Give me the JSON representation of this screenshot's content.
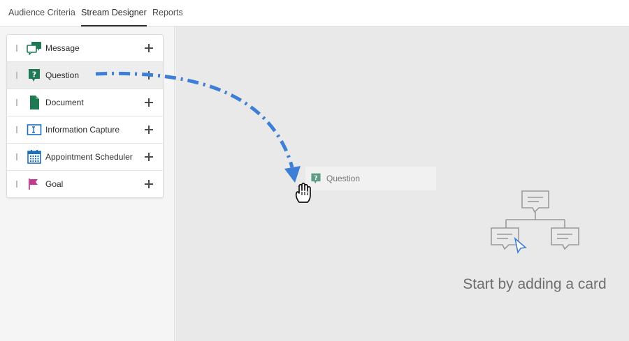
{
  "tabs": [
    {
      "label": "Audience Criteria",
      "active": false
    },
    {
      "label": "Stream Designer",
      "active": true
    },
    {
      "label": "Reports",
      "active": false
    }
  ],
  "cards": [
    {
      "label": "Message",
      "icon": "message-icon",
      "color": "#1e7a52"
    },
    {
      "label": "Question",
      "icon": "question-icon",
      "color": "#1e7a52"
    },
    {
      "label": "Document",
      "icon": "document-icon",
      "color": "#1e7a52"
    },
    {
      "label": "Information Capture",
      "icon": "information-capture-icon",
      "color": "#1d6fbd"
    },
    {
      "label": "Appointment Scheduler",
      "icon": "calendar-icon",
      "color": "#1d6fbd"
    },
    {
      "label": "Goal",
      "icon": "flag-icon",
      "color": "#c2398d"
    }
  ],
  "drag_ghost": {
    "label": "Question",
    "icon": "question-icon"
  },
  "empty_state": {
    "text": "Start by adding a card"
  },
  "colors": {
    "accent_blue": "#3d7fd6",
    "green": "#1e7a52",
    "magenta": "#c2398d"
  }
}
